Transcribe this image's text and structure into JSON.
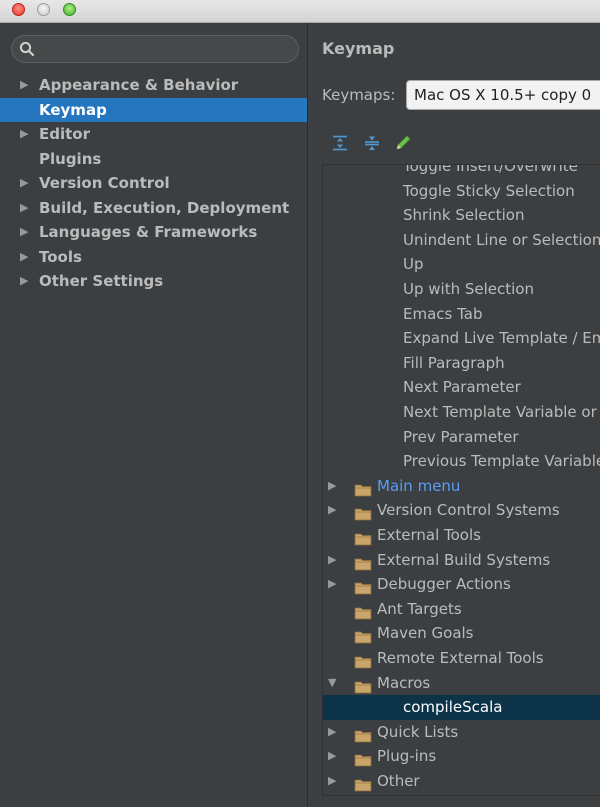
{
  "window": {
    "title": ""
  },
  "search": {
    "placeholder": "",
    "icon": "search-icon"
  },
  "sidebar": {
    "items": [
      {
        "label": "Appearance & Behavior",
        "expandable": true
      },
      {
        "label": "Keymap",
        "expandable": false,
        "selected": true
      },
      {
        "label": "Editor",
        "expandable": true
      },
      {
        "label": "Plugins",
        "expandable": false
      },
      {
        "label": "Version Control",
        "expandable": true
      },
      {
        "label": "Build, Execution, Deployment",
        "expandable": true
      },
      {
        "label": "Languages & Frameworks",
        "expandable": true
      },
      {
        "label": "Tools",
        "expandable": true
      },
      {
        "label": "Other Settings",
        "expandable": true
      }
    ]
  },
  "main": {
    "heading": "Keymap",
    "keymaps_label": "Keymaps:",
    "keymaps_value": "Mac OS X 10.5+ copy 0",
    "toolbar": [
      "expand-all-icon",
      "collapse-all-icon",
      "edit-icon"
    ]
  },
  "tree": {
    "rows": [
      {
        "kind": "action",
        "label": "Toggle Insert/Overwrite"
      },
      {
        "kind": "action",
        "label": "Toggle Sticky Selection"
      },
      {
        "kind": "action",
        "label": "Shrink Selection"
      },
      {
        "kind": "action",
        "label": "Unindent Line or Selection"
      },
      {
        "kind": "action",
        "label": "Up"
      },
      {
        "kind": "action",
        "label": "Up with Selection"
      },
      {
        "kind": "action",
        "label": "Emacs Tab"
      },
      {
        "kind": "action",
        "label": "Expand Live Template / Emmet"
      },
      {
        "kind": "action",
        "label": "Fill Paragraph"
      },
      {
        "kind": "action",
        "label": "Next Parameter"
      },
      {
        "kind": "action",
        "label": "Next Template Variable or Tab"
      },
      {
        "kind": "action",
        "label": "Prev Parameter"
      },
      {
        "kind": "action",
        "label": "Previous Template Variable"
      },
      {
        "kind": "group",
        "label": "Main menu",
        "arrow": "right",
        "highlight": true
      },
      {
        "kind": "group",
        "label": "Version Control Systems",
        "arrow": "right"
      },
      {
        "kind": "group",
        "label": "External Tools",
        "arrow": ""
      },
      {
        "kind": "group",
        "label": "External Build Systems",
        "arrow": "right"
      },
      {
        "kind": "group",
        "label": "Debugger Actions",
        "arrow": "right"
      },
      {
        "kind": "group",
        "label": "Ant Targets",
        "arrow": ""
      },
      {
        "kind": "group",
        "label": "Maven Goals",
        "arrow": ""
      },
      {
        "kind": "group",
        "label": "Remote External Tools",
        "arrow": ""
      },
      {
        "kind": "group",
        "label": "Macros",
        "arrow": "down"
      },
      {
        "kind": "action",
        "label": "compileScala",
        "selected": true
      },
      {
        "kind": "group",
        "label": "Quick Lists",
        "arrow": "right"
      },
      {
        "kind": "group",
        "label": "Plug-ins",
        "arrow": "right"
      },
      {
        "kind": "group",
        "label": "Other",
        "arrow": "right"
      }
    ]
  },
  "colors": {
    "background": "#3c3f41",
    "selection_sidebar": "#2675bf",
    "selection_tree": "#0d3349",
    "link_blue": "#589df6",
    "folder": "#c9a46b"
  }
}
